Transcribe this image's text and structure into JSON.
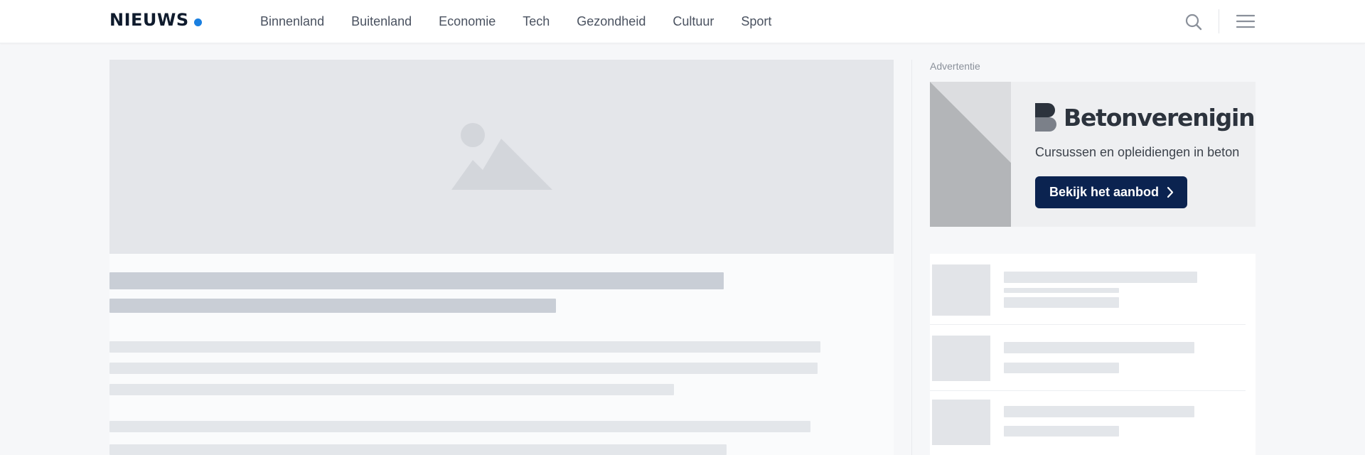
{
  "header": {
    "logo_text": "NIEUWS",
    "accent_color": "#1a7fe0",
    "nav_items": [
      {
        "label": "Binnenland"
      },
      {
        "label": "Buitenland"
      },
      {
        "label": "Economie"
      },
      {
        "label": "Tech"
      },
      {
        "label": "Gezondheid"
      },
      {
        "label": "Cultuur"
      },
      {
        "label": "Sport"
      }
    ],
    "icons": {
      "search": "search-icon",
      "menu": "hamburger-menu-icon"
    }
  },
  "article": {
    "hero_icon": "image-placeholder-icon",
    "loading_state": "skeleton"
  },
  "advertisement": {
    "label": "Advertentie",
    "brand_name": "Betonvereniging",
    "tagline": "Cursussen en opleidiengen in beton",
    "cta_label": "Bekijk het aanbod",
    "cta_icon": "chevron-right-icon",
    "cta_color": "#0b2350"
  },
  "sidebar": {
    "loading_state": "skeleton",
    "item_count": 3
  }
}
